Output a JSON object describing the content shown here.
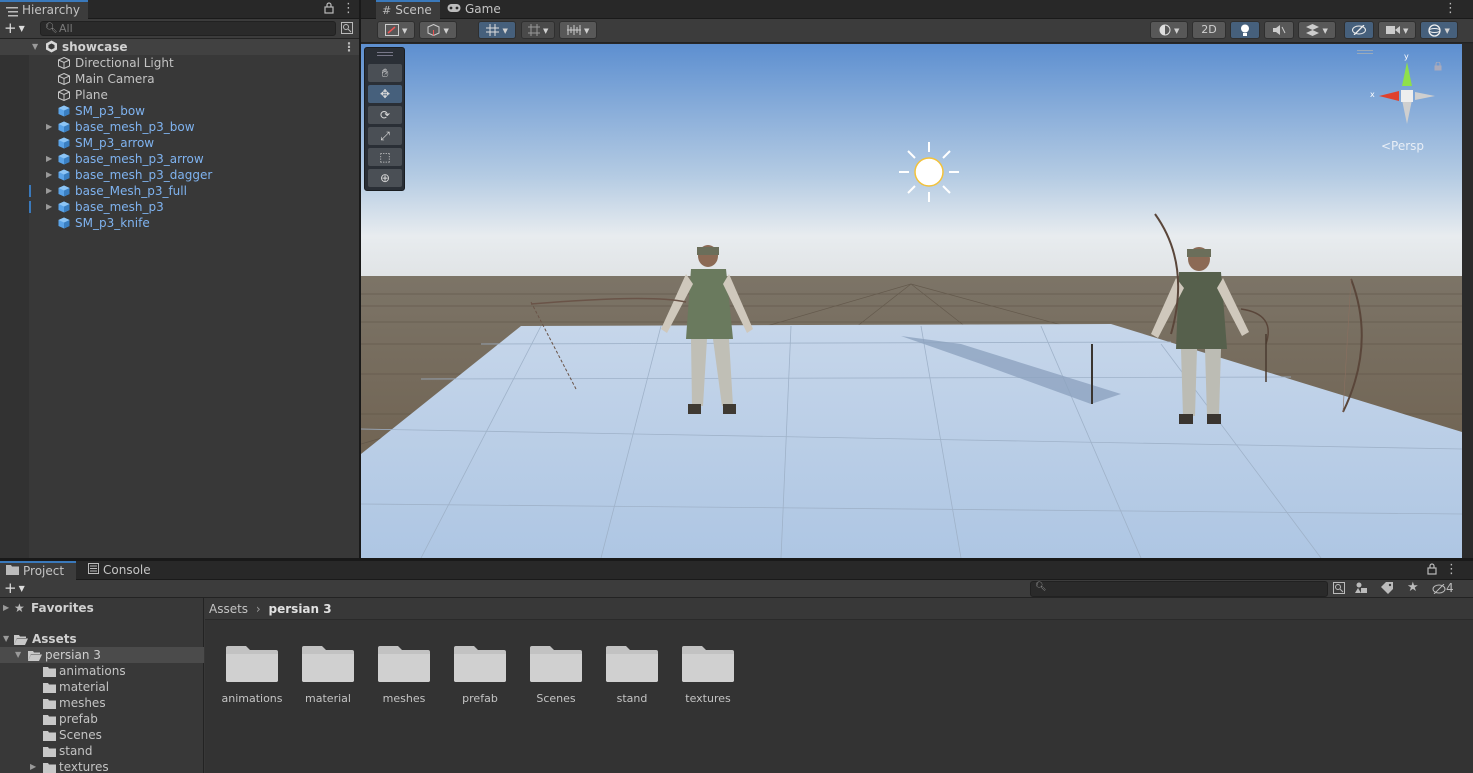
{
  "hierarchy": {
    "tab_label": "Hierarchy",
    "search_placeholder": "All",
    "scene_name": "showcase",
    "items": [
      {
        "label": "Directional Light",
        "prefab": false,
        "expandable": false,
        "marked": false
      },
      {
        "label": "Main Camera",
        "prefab": false,
        "expandable": false,
        "marked": false
      },
      {
        "label": "Plane",
        "prefab": false,
        "expandable": false,
        "marked": false
      },
      {
        "label": "SM_p3_bow",
        "prefab": true,
        "expandable": false,
        "marked": false
      },
      {
        "label": "base_mesh_p3_bow",
        "prefab": true,
        "expandable": true,
        "marked": false
      },
      {
        "label": "SM_p3_arrow",
        "prefab": true,
        "expandable": false,
        "marked": false
      },
      {
        "label": "base_mesh_p3_arrow",
        "prefab": true,
        "expandable": true,
        "marked": false
      },
      {
        "label": "base_mesh_p3_dagger",
        "prefab": true,
        "expandable": true,
        "marked": false
      },
      {
        "label": "base_Mesh_p3_full",
        "prefab": true,
        "expandable": true,
        "marked": true
      },
      {
        "label": "base_mesh_p3",
        "prefab": true,
        "expandable": true,
        "marked": true
      },
      {
        "label": "SM_p3_knife",
        "prefab": true,
        "expandable": false,
        "marked": false
      }
    ]
  },
  "scene_view": {
    "tabs": [
      {
        "label": "Scene"
      },
      {
        "label": "Game"
      }
    ],
    "mode_2d_label": "2D",
    "persp_label": "<Persp",
    "gizmo_axes": {
      "x": "x",
      "y": "y"
    }
  },
  "project": {
    "tabs": [
      {
        "label": "Project"
      },
      {
        "label": "Console"
      }
    ],
    "favorites_label": "Favorites",
    "assets_label": "Assets",
    "selected_folder": "persian 3",
    "tree": [
      "animations",
      "material",
      "meshes",
      "prefab",
      "Scenes",
      "stand",
      "textures"
    ],
    "breadcrumb": [
      "Assets",
      "persian 3"
    ],
    "folders": [
      "animations",
      "material",
      "meshes",
      "prefab",
      "Scenes",
      "stand",
      "textures"
    ],
    "hidden_count": "4"
  },
  "colors": {
    "accent": "#3a79bb",
    "prefab_text": "#7fb3f0",
    "sky_top": "#5d8fd0",
    "horizon": "#e8ecef",
    "ground": "#6a5d4d",
    "plane": "#b9cde6"
  }
}
